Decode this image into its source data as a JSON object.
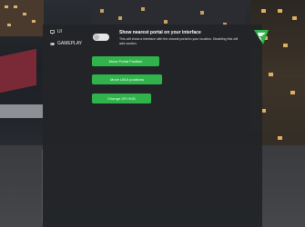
{
  "nav": {
    "items": [
      {
        "label": "UI",
        "icon": "monitor-icon"
      },
      {
        "label": "GAMEPLAY",
        "icon": "gamepad-icon"
      }
    ]
  },
  "setting": {
    "title": "Show nearest portal on your interface",
    "description": "This will show a interface with the closest portal to your location. Disabling this will add caution.",
    "toggle_state": "off"
  },
  "buttons": {
    "move_portal": "Move Portal Position",
    "move_ui": "Move UI/UI positions",
    "change_gr": "Change GR HUD"
  },
  "colors": {
    "accent": "#2fb34a",
    "panel": "#222428",
    "text": "#ffffff"
  }
}
